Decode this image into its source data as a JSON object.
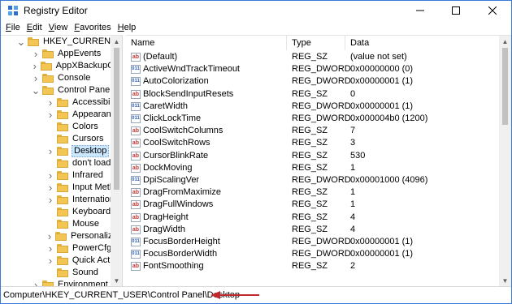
{
  "title": "Registry Editor",
  "menu": [
    "File",
    "Edit",
    "View",
    "Favorites",
    "Help"
  ],
  "tree": [
    {
      "label": "HKEY_CURRENT_US",
      "level": 0,
      "expander": "down"
    },
    {
      "label": "AppEvents",
      "level": 1,
      "expander": "right"
    },
    {
      "label": "AppXBackupCor",
      "level": 1,
      "expander": "right"
    },
    {
      "label": "Console",
      "level": 1,
      "expander": "right"
    },
    {
      "label": "Control Panel",
      "level": 1,
      "expander": "down"
    },
    {
      "label": "Accessibility",
      "level": 2,
      "expander": "right"
    },
    {
      "label": "Appearance",
      "level": 2,
      "expander": "right"
    },
    {
      "label": "Colors",
      "level": 2,
      "expander": "none"
    },
    {
      "label": "Cursors",
      "level": 2,
      "expander": "none"
    },
    {
      "label": "Desktop",
      "level": 2,
      "expander": "right",
      "selected": true
    },
    {
      "label": "don't load",
      "level": 2,
      "expander": "none"
    },
    {
      "label": "Infrared",
      "level": 2,
      "expander": "right"
    },
    {
      "label": "Input Metho",
      "level": 2,
      "expander": "right"
    },
    {
      "label": "International",
      "level": 2,
      "expander": "right"
    },
    {
      "label": "Keyboard",
      "level": 2,
      "expander": "none"
    },
    {
      "label": "Mouse",
      "level": 2,
      "expander": "none"
    },
    {
      "label": "Personalizati",
      "level": 2,
      "expander": "right"
    },
    {
      "label": "PowerCfg",
      "level": 2,
      "expander": "right"
    },
    {
      "label": "Quick Action",
      "level": 2,
      "expander": "right"
    },
    {
      "label": "Sound",
      "level": 2,
      "expander": "none"
    },
    {
      "label": "Environment",
      "level": 1,
      "expander": "right"
    }
  ],
  "columns": {
    "name": "Name",
    "type": "Type",
    "data": "Data"
  },
  "values": [
    {
      "name": "(Default)",
      "type": "REG_SZ",
      "data": "(value not set)",
      "kind": "ab"
    },
    {
      "name": "ActiveWndTrackTimeout",
      "type": "REG_DWORD",
      "data": "0x00000000 (0)",
      "kind": "bin"
    },
    {
      "name": "AutoColorization",
      "type": "REG_DWORD",
      "data": "0x00000001 (1)",
      "kind": "bin"
    },
    {
      "name": "BlockSendInputResets",
      "type": "REG_SZ",
      "data": "0",
      "kind": "ab"
    },
    {
      "name": "CaretWidth",
      "type": "REG_DWORD",
      "data": "0x00000001 (1)",
      "kind": "bin"
    },
    {
      "name": "ClickLockTime",
      "type": "REG_DWORD",
      "data": "0x000004b0 (1200)",
      "kind": "bin"
    },
    {
      "name": "CoolSwitchColumns",
      "type": "REG_SZ",
      "data": "7",
      "kind": "ab"
    },
    {
      "name": "CoolSwitchRows",
      "type": "REG_SZ",
      "data": "3",
      "kind": "ab"
    },
    {
      "name": "CursorBlinkRate",
      "type": "REG_SZ",
      "data": "530",
      "kind": "ab"
    },
    {
      "name": "DockMoving",
      "type": "REG_SZ",
      "data": "1",
      "kind": "ab"
    },
    {
      "name": "DpiScalingVer",
      "type": "REG_DWORD",
      "data": "0x00001000 (4096)",
      "kind": "bin"
    },
    {
      "name": "DragFromMaximize",
      "type": "REG_SZ",
      "data": "1",
      "kind": "ab"
    },
    {
      "name": "DragFullWindows",
      "type": "REG_SZ",
      "data": "1",
      "kind": "ab"
    },
    {
      "name": "DragHeight",
      "type": "REG_SZ",
      "data": "4",
      "kind": "ab"
    },
    {
      "name": "DragWidth",
      "type": "REG_SZ",
      "data": "4",
      "kind": "ab"
    },
    {
      "name": "FocusBorderHeight",
      "type": "REG_DWORD",
      "data": "0x00000001 (1)",
      "kind": "bin"
    },
    {
      "name": "FocusBorderWidth",
      "type": "REG_DWORD",
      "data": "0x00000001 (1)",
      "kind": "bin"
    },
    {
      "name": "FontSmoothing",
      "type": "REG_SZ",
      "data": "2",
      "kind": "ab"
    }
  ],
  "status_path": "Computer\\HKEY_CURRENT_USER\\Control Panel\\Desktop",
  "colors": {
    "accent_border": "#3a7bd5",
    "folder": "#f3c653",
    "selection": "#cce8ff",
    "annotation_arrow": "#c0282d"
  }
}
